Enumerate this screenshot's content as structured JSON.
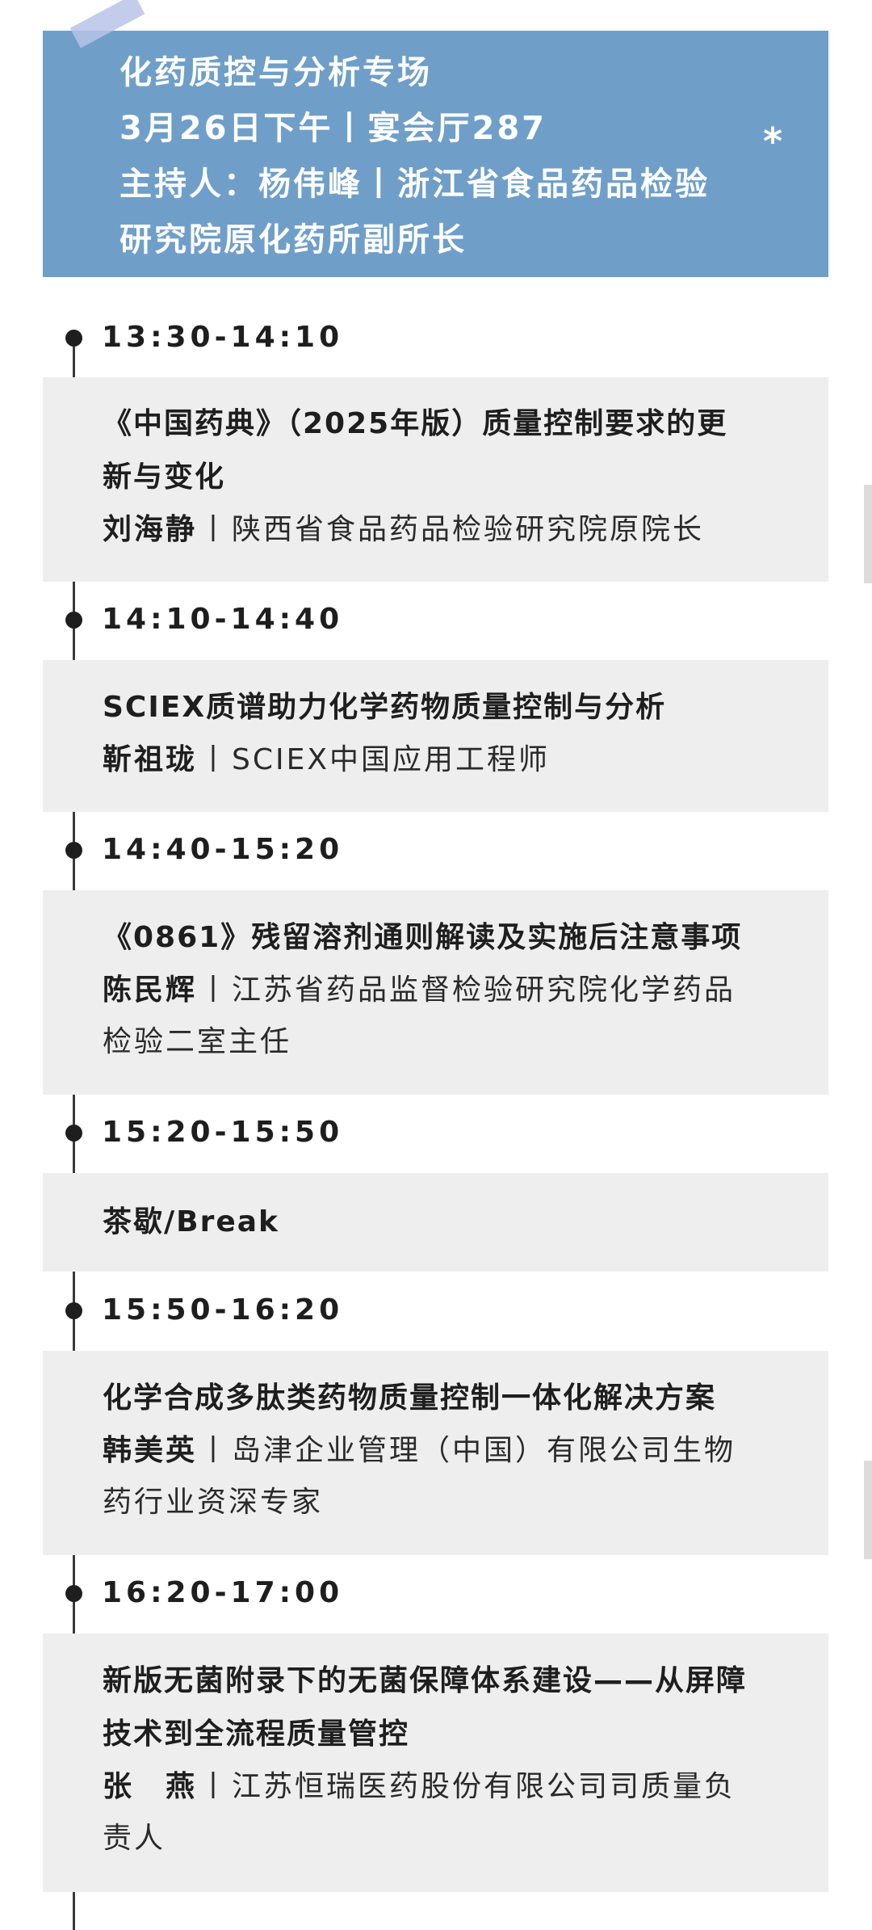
{
  "header": {
    "lines": [
      "化药质控与分析专场",
      "3月26日下午丨宴会厅287",
      "主持人：杨伟峰丨浙江省食品药品检验",
      "研究院原化药所副所长"
    ],
    "asterisk": "*"
  },
  "schedule": [
    {
      "time": "13:30-14:10",
      "title_lines": [
        "《中国药典》（2025年版）质量控制要求的更",
        "新与变化"
      ],
      "speaker": "刘海静",
      "sep": "丨",
      "affil_lines": [
        "陕西省食品药品检验研究院原院长"
      ]
    },
    {
      "time": "14:10-14:40",
      "title_lines": [
        "SCIEX质谱助力化学药物质量控制与分析"
      ],
      "speaker": "靳祖珑",
      "sep": "丨",
      "affil_lines": [
        "SCIEX中国应用工程师"
      ]
    },
    {
      "time": "14:40-15:20",
      "title_lines": [
        "《0861》残留溶剂通则解读及实施后注意事项"
      ],
      "speaker": "陈民辉",
      "sep": "丨",
      "affil_lines": [
        "江苏省药品监督检验研究院化学药品",
        "检验二室主任"
      ]
    },
    {
      "time": "15:20-15:50",
      "title_lines": [
        "茶歇/Break"
      ]
    },
    {
      "time": "15:50-16:20",
      "title_lines": [
        "化学合成多肽类药物质量控制一体化解决方案"
      ],
      "speaker": "韩美英",
      "sep": "丨",
      "affil_lines": [
        "岛津企业管理（中国）有限公司生物",
        "药行业资深专家"
      ]
    },
    {
      "time": "16:20-17:00",
      "title_lines": [
        "新版无菌附录下的无菌保障体系建设——从屏障",
        "技术到全流程质量管控"
      ],
      "speaker": "张　燕",
      "sep": "丨",
      "affil_lines": [
        "江苏恒瑞医药股份有限公司司质量负",
        "责人"
      ]
    }
  ]
}
